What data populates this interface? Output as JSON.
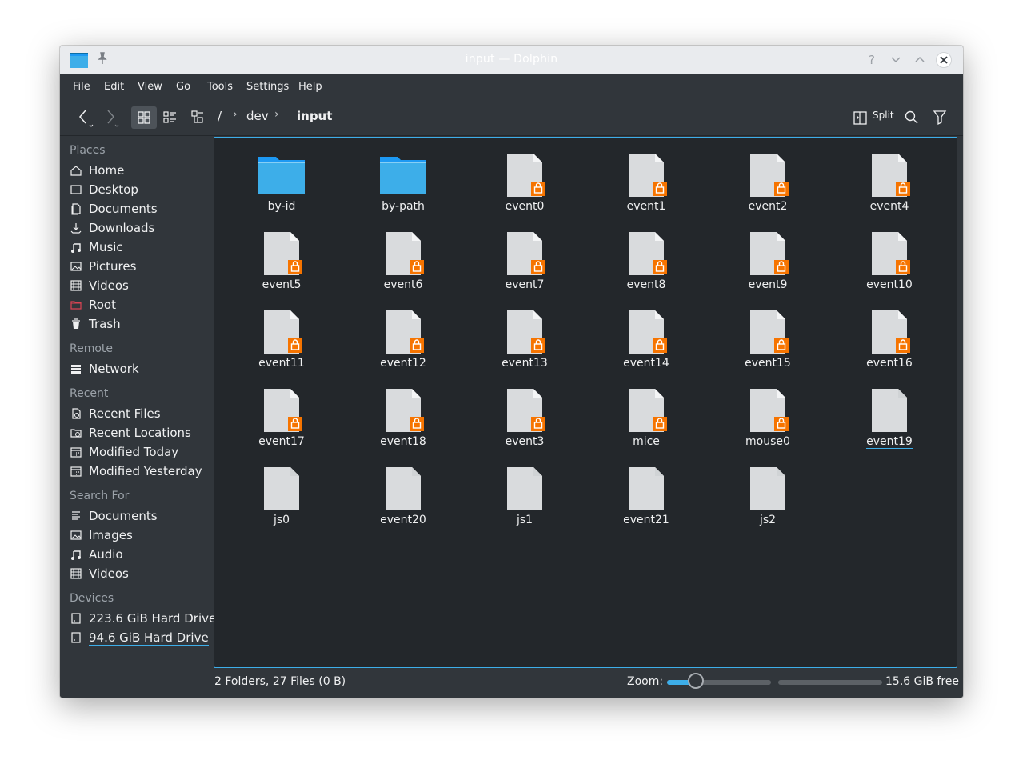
{
  "window": {
    "title": "input — Dolphin"
  },
  "menu": [
    "File",
    "Edit",
    "View",
    "Go",
    "Tools",
    "Settings",
    "Help"
  ],
  "breadcrumb": {
    "root": "/",
    "parts": [
      "dev",
      "input"
    ]
  },
  "toolbar": {
    "split_label": "Split"
  },
  "sidebar": {
    "places_title": "Places",
    "places": [
      {
        "label": "Home",
        "icon": "home-icon"
      },
      {
        "label": "Desktop",
        "icon": "desktop-icon"
      },
      {
        "label": "Documents",
        "icon": "documents-icon"
      },
      {
        "label": "Downloads",
        "icon": "downloads-icon"
      },
      {
        "label": "Music",
        "icon": "music-icon"
      },
      {
        "label": "Pictures",
        "icon": "pictures-icon"
      },
      {
        "label": "Videos",
        "icon": "videos-icon"
      },
      {
        "label": "Root",
        "icon": "root-folder-icon"
      },
      {
        "label": "Trash",
        "icon": "trash-icon"
      }
    ],
    "remote_title": "Remote",
    "remote": [
      {
        "label": "Network",
        "icon": "network-icon"
      }
    ],
    "recent_title": "Recent",
    "recent": [
      {
        "label": "Recent Files",
        "icon": "recent-files-icon"
      },
      {
        "label": "Recent Locations",
        "icon": "recent-locations-icon"
      },
      {
        "label": "Modified Today",
        "icon": "calendar-icon"
      },
      {
        "label": "Modified Yesterday",
        "icon": "calendar-icon"
      }
    ],
    "search_title": "Search For",
    "search": [
      {
        "label": "Documents",
        "icon": "documents-search-icon"
      },
      {
        "label": "Images",
        "icon": "images-icon"
      },
      {
        "label": "Audio",
        "icon": "audio-icon"
      },
      {
        "label": "Videos",
        "icon": "videos-icon"
      }
    ],
    "devices_title": "Devices",
    "devices": [
      {
        "label": "223.6 GiB Hard Drive",
        "icon": "hard-drive-icon"
      },
      {
        "label": "94.6 GiB Hard Drive",
        "icon": "hard-drive-icon"
      }
    ]
  },
  "files": [
    {
      "name": "by-id",
      "type": "folder"
    },
    {
      "name": "by-path",
      "type": "folder"
    },
    {
      "name": "event0",
      "type": "locked"
    },
    {
      "name": "event1",
      "type": "locked"
    },
    {
      "name": "event2",
      "type": "locked"
    },
    {
      "name": "event4",
      "type": "locked"
    },
    {
      "name": "event5",
      "type": "locked"
    },
    {
      "name": "event6",
      "type": "locked"
    },
    {
      "name": "event7",
      "type": "locked"
    },
    {
      "name": "event8",
      "type": "locked"
    },
    {
      "name": "event9",
      "type": "locked"
    },
    {
      "name": "event10",
      "type": "locked"
    },
    {
      "name": "event11",
      "type": "locked"
    },
    {
      "name": "event12",
      "type": "locked"
    },
    {
      "name": "event13",
      "type": "locked"
    },
    {
      "name": "event14",
      "type": "locked"
    },
    {
      "name": "event15",
      "type": "locked"
    },
    {
      "name": "event16",
      "type": "locked"
    },
    {
      "name": "event17",
      "type": "locked"
    },
    {
      "name": "event18",
      "type": "locked"
    },
    {
      "name": "event3",
      "type": "locked"
    },
    {
      "name": "mice",
      "type": "locked"
    },
    {
      "name": "mouse0",
      "type": "locked"
    },
    {
      "name": "event19",
      "type": "file",
      "hover": true
    },
    {
      "name": "js0",
      "type": "file"
    },
    {
      "name": "event20",
      "type": "file"
    },
    {
      "name": "js1",
      "type": "file"
    },
    {
      "name": "event21",
      "type": "file"
    },
    {
      "name": "js2",
      "type": "file"
    }
  ],
  "status": {
    "summary": "2 Folders, 27 Files (0 B)",
    "zoom_label": "Zoom:",
    "zoom_fraction": 0.28,
    "free_space": "15.6 GiB free"
  },
  "colors": {
    "accent": "#3daee9",
    "lock": "#f67400",
    "folder": "#3daee9"
  }
}
